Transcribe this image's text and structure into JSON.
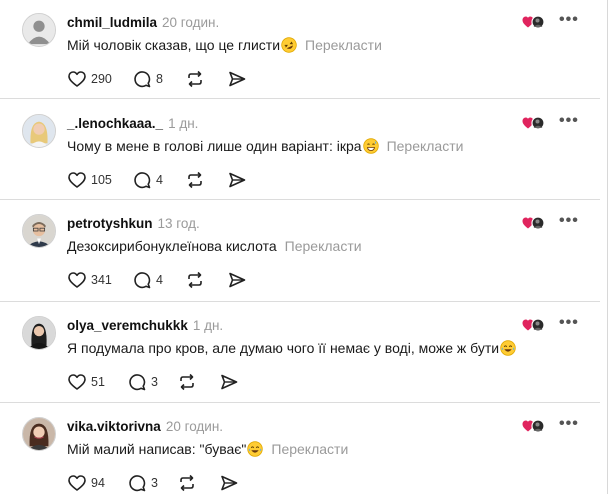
{
  "comments": [
    {
      "username": "chmil_ludmila",
      "time": "20 годин.",
      "text": "Мій чоловік сказав, що це глисти",
      "emoji": "rofl-emoji",
      "translate": "Перекласти",
      "likes": "290",
      "replies": "8"
    },
    {
      "username": "_.lenochkaaa._",
      "time": "1 дн.",
      "text": "Чому в мене в голові лише один варіант: ікра",
      "emoji": "grin-sweat-emoji",
      "translate": "Перекласти",
      "likes": "105",
      "replies": "4"
    },
    {
      "username": "petrotyshkun",
      "time": "13 год.",
      "text": "Дезоксирибонуклеїнова кислота",
      "emoji": "",
      "translate": "Перекласти",
      "likes": "341",
      "replies": "4"
    },
    {
      "username": "olya_veremchukkk",
      "time": "1 дн.",
      "text": "Я подумала про кров, але думаю чого її немає у воді, може ж бути",
      "emoji": "laughing-emoji",
      "translate": "",
      "likes": "51",
      "replies": "3"
    },
    {
      "username": "vika.viktorivna",
      "time": "20 годин.",
      "text": "Мій малий написав: \"буває\"",
      "emoji": "laughing-emoji",
      "translate": "Перекласти",
      "likes": "94",
      "replies": "3"
    }
  ],
  "colors": {
    "heart_red": "#e0245e",
    "muted_text": "#9a9a9a",
    "emoji_yellow": "#ffcc33"
  },
  "icons": {
    "like": "heart-outline-icon",
    "reply": "speech-bubble-icon",
    "repost": "repost-arrows-icon",
    "share": "send-paper-plane-icon",
    "more": "more-horizontal-icon",
    "liked_by_author": "author-liked-indicator-icon"
  }
}
